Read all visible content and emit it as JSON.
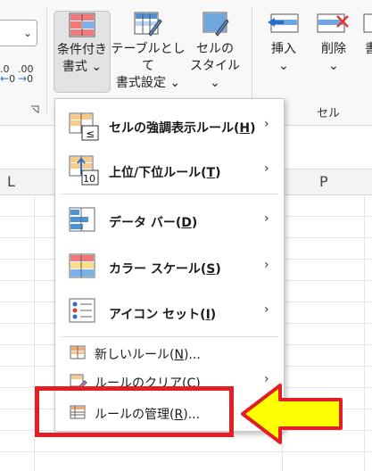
{
  "ribbon": {
    "conditional_format": {
      "line1": "条件付き",
      "line2": "書式",
      "caret": "⌄"
    },
    "format_as_table": {
      "line1": "テーブルとして",
      "line2": "書式設定",
      "caret": "⌄"
    },
    "cell_styles": {
      "line1": "セルの",
      "line2": "スタイル",
      "caret": "⌄"
    },
    "insert": {
      "label": "挿入",
      "caret": "⌄"
    },
    "delete": {
      "label": "削除",
      "caret": "⌄"
    },
    "format_partial": "書",
    "cells_group_label": "セル",
    "dropdown_chevron": "⌄",
    "decimal_inc": ".0",
    "decimal_inc_sub": "0",
    "decimal_dec": ".00",
    "decimal_dec_sub": "0"
  },
  "sheet": {
    "columns": [
      "L",
      "P"
    ]
  },
  "menu": {
    "items": [
      {
        "label_pre": "セルの強調表示ルール(",
        "key": "H",
        "label_post": ")",
        "icon": "highlight-cells-icon",
        "submenu": "›"
      },
      {
        "label_pre": "上位/下位ルール(",
        "key": "T",
        "label_post": ")",
        "icon": "top-bottom-icon",
        "submenu": "›"
      },
      {
        "label_pre": "データ バー(",
        "key": "D",
        "label_post": ")",
        "icon": "data-bar-icon",
        "submenu": "›"
      },
      {
        "label_pre": "カラー スケール(",
        "key": "S",
        "label_post": ")",
        "icon": "color-scale-icon",
        "submenu": "›"
      },
      {
        "label_pre": "アイコン セット(",
        "key": "I",
        "label_post": ")",
        "icon": "icon-set-icon",
        "submenu": "›"
      }
    ],
    "small_items": [
      {
        "label_pre": "新しいルール(",
        "key": "N",
        "label_post": ")...",
        "icon": "new-rule-icon"
      },
      {
        "label_pre": "ルールのクリア(",
        "key": "C",
        "label_post": ")",
        "icon": "clear-rules-icon",
        "submenu": "›"
      },
      {
        "label_pre": "ルールの管理(",
        "key": "R",
        "label_post": ")...",
        "icon": "manage-rules-icon"
      }
    ]
  },
  "colors": {
    "highlight_box": "#e41e25",
    "arrow_fill": "#ffff00",
    "arrow_stroke": "#e41e25",
    "accent_blue": "#2b6cc4"
  }
}
